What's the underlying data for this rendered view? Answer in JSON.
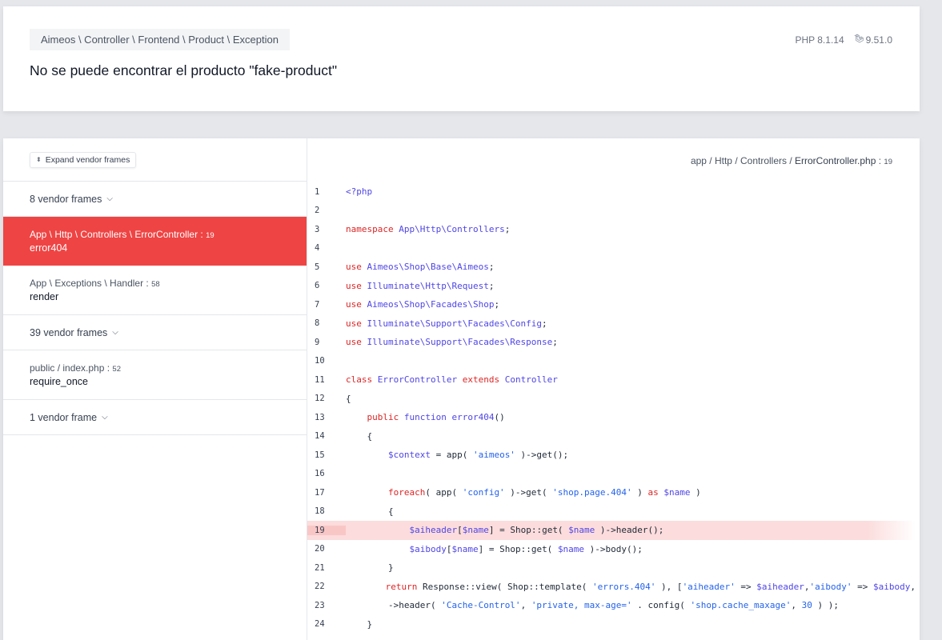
{
  "header": {
    "exception_class": "Aimeos \\ Controller \\ Frontend \\ Product \\ Exception",
    "message": "No se puede encontrar el producto \"fake-product\"",
    "php_version": "PHP 8.1.14",
    "laravel_version": "9.51.0"
  },
  "sidebar": {
    "expand_label": "Expand vendor frames",
    "items": [
      {
        "type": "group",
        "label": "8 vendor frames"
      },
      {
        "type": "frame",
        "path": "App \\ Http \\ Controllers \\ ErrorController",
        "line": "19",
        "method": "error404",
        "active": true
      },
      {
        "type": "frame",
        "path": "App \\ Exceptions \\ Handler",
        "line": "58",
        "method": "render"
      },
      {
        "type": "group",
        "label": "39 vendor frames"
      },
      {
        "type": "frame",
        "path_dir": "public / ",
        "path_file": "index.php",
        "line": "52",
        "method": "require_once"
      },
      {
        "type": "group",
        "label": "1 vendor frame"
      }
    ]
  },
  "code": {
    "file_dir": "app / Http / Controllers / ",
    "file_name": "ErrorController.php",
    "file_line": "19",
    "highlight_line": 19,
    "lines": [
      "1",
      "2",
      "3",
      "4",
      "5",
      "6",
      "7",
      "8",
      "9",
      "10",
      "11",
      "12",
      "13",
      "14",
      "15",
      "16",
      "17",
      "18",
      "19",
      "20",
      "21",
      "22",
      "23",
      "24"
    ]
  }
}
